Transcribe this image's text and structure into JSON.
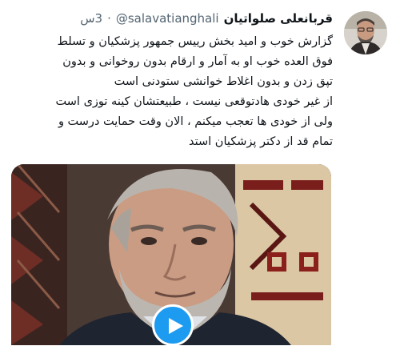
{
  "tweet": {
    "author_name": "قربانعلی صلواتیان",
    "handle": "@salavatianghali",
    "separator": "·",
    "time": "3س",
    "lines": [
      "گزارش خوب و امید بخش رییس جمهور پزشکیان و تسلط",
      "فوق العده خوب او به آمار و ارقام بدون روخوانی و بدون",
      "تپق زدن و بدون اغلاط خوانشی ستودنی است",
      "از غیر خودی هادتوقعی نیست ، طبیعتشان کینه توزی است",
      "ولی از خودی ها تعجب میکنم ، الان وقت حمایت درست و",
      "تمام قد از دکتر پزشکیان استد"
    ]
  },
  "media": {
    "type": "video",
    "play_icon": "play-icon"
  },
  "colors": {
    "accent": "#1d9bf0",
    "text": "#0f1419",
    "muted": "#536471"
  }
}
